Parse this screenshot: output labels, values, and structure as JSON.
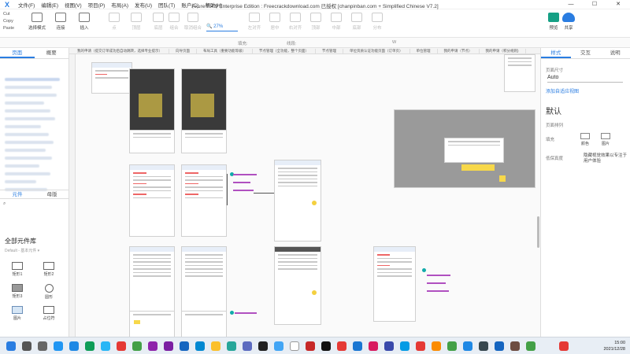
{
  "titlebar": {
    "app_icon": "X",
    "menus": [
      "文件(F)",
      "编辑(E)",
      "视图(V)",
      "项目(P)",
      "布局(A)",
      "发布(U)",
      "团队(T)",
      "账户(C)",
      "帮助(H)"
    ],
    "window_title": "Axure RP 9 Enterprise Edition : Freecrackdownload.com 已授权    [chanpinban.com + Simplified Chinese V7.2]",
    "controls": [
      "—",
      "☐",
      "✕"
    ]
  },
  "toolbar": {
    "clipboard": [
      "Cut",
      "Copy",
      "Paste"
    ],
    "tools": [
      "选择模式",
      "连接",
      "插入"
    ],
    "dim_tools": [
      "点",
      "顶层",
      "底层",
      "组合",
      "取消组合"
    ],
    "zoom": "27%",
    "dim_tools_right": [
      "左对齐",
      "居中",
      "右对齐",
      "顶部",
      "中部",
      "底部",
      "分布"
    ],
    "preview": "预览",
    "share": "共享"
  },
  "stylebar": {
    "fill_label": "填充:",
    "line_label": "线段:",
    "w_label": "W"
  },
  "left": {
    "tabs": [
      "页面",
      "概要"
    ],
    "library_tabs": [
      "元件",
      "母版"
    ],
    "search_icon": "search-icon",
    "library_title": "全部元件库",
    "library_sub": "Default - 基本元件 ▾",
    "widgets": [
      "矩形1",
      "矩形2",
      "矩形3",
      "圆形",
      "图片",
      "占位符"
    ]
  },
  "canvas": {
    "tabs": [
      "我的申请（提交订单成功后自动跳转，选择专业提示）",
      "向导页面",
      "布局工具（重要功能等级）",
      "节点管理（全功能，整个页面）",
      "节点管理",
      "单位资质认证功能页面（订单页）",
      "单位管理",
      "我的申请（节点）",
      "我的申请（积分规则)"
    ]
  },
  "right": {
    "tabs": [
      "样式",
      "交互",
      "说明"
    ],
    "size_label": "页面尺寸",
    "size_value": "Auto",
    "adaptive_link": "添加自适应视图",
    "default_heading": "默认",
    "align_label": "页面排列",
    "fill_label": "填充",
    "fill_options": [
      "颜色",
      "图片"
    ],
    "low_fidelity_label": "低保真度",
    "low_fidelity_text": "隐藏视觉效果以专注于用户体验"
  },
  "taskbar": {
    "time": "15:00",
    "date": "2021/12/28"
  }
}
